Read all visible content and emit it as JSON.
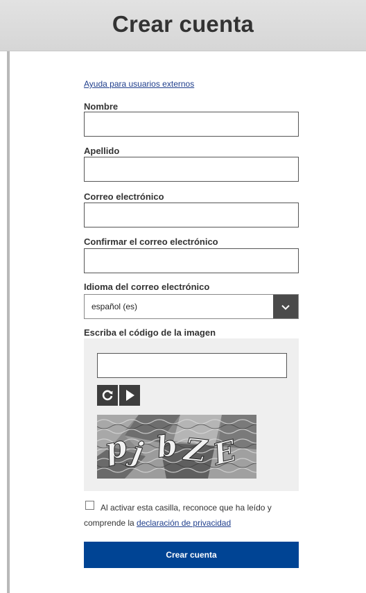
{
  "header": {
    "title": "Crear cuenta"
  },
  "help_link": "Ayuda para usuarios externos",
  "fields": {
    "first_name": {
      "label": "Nombre",
      "value": ""
    },
    "last_name": {
      "label": "Apellido",
      "value": ""
    },
    "email": {
      "label": "Correo electrónico",
      "value": ""
    },
    "email_confirm": {
      "label": "Confirmar el correo electrónico",
      "value": ""
    }
  },
  "language": {
    "label": "Idioma del correo electrónico",
    "selected": "español (es)"
  },
  "captcha": {
    "label": "Escriba el código de la imagen",
    "value": "",
    "refresh_icon": "refresh-icon",
    "play_icon": "play-audio-icon",
    "image_text": "p j b Z E"
  },
  "consent": {
    "text_before": "Al activar esta casilla, reconoce que ha leído y comprende la ",
    "link": "declaración de privacidad"
  },
  "submit_label": "Crear cuenta",
  "colors": {
    "primary": "#004494",
    "link": "#1f3e8c",
    "header_bg": "#dcdcdc"
  }
}
